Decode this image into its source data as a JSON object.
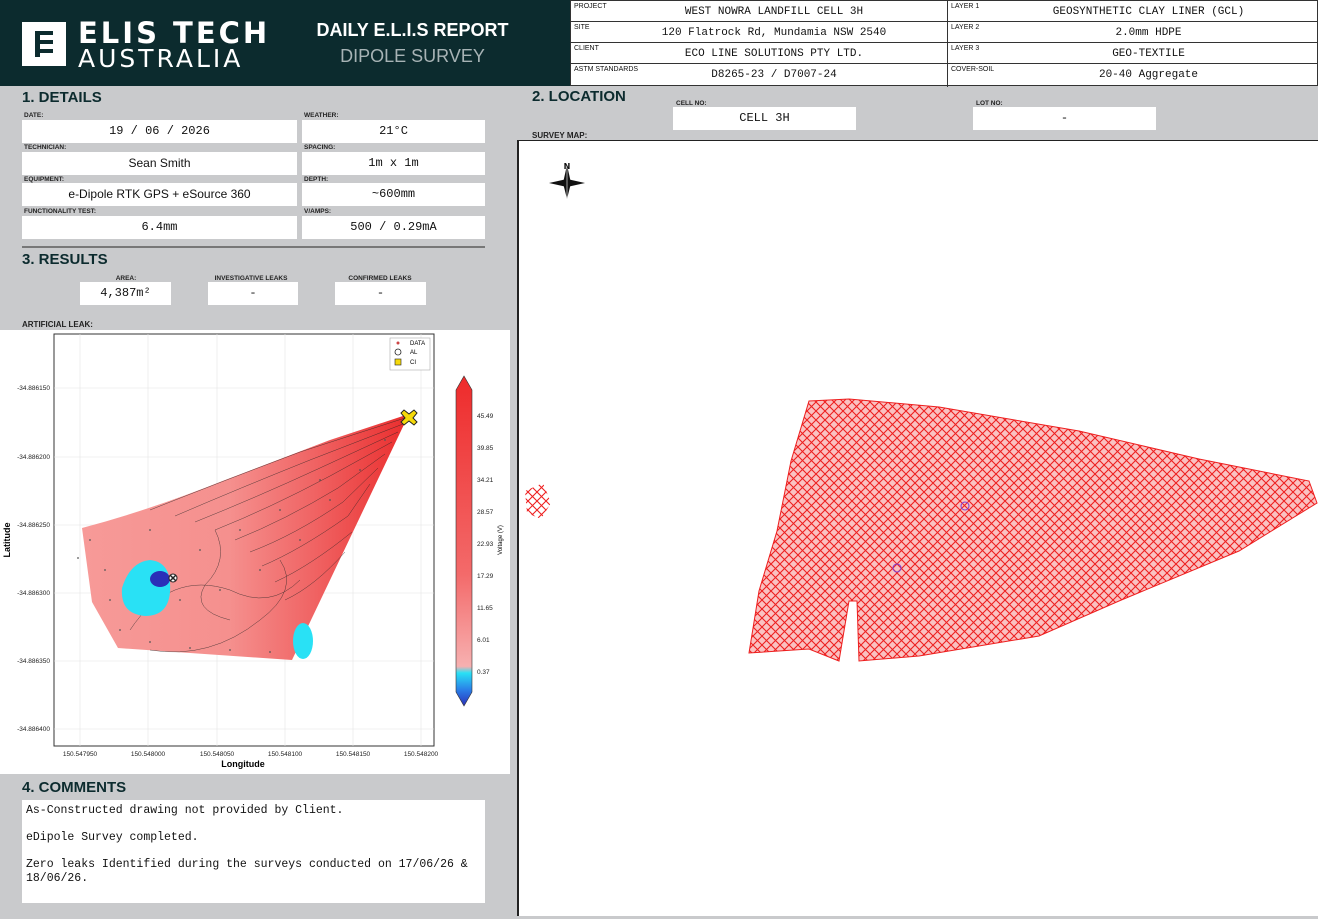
{
  "brand": {
    "line1": "ELIS TECH",
    "line2": "AUSTRALIA"
  },
  "report": {
    "title": "DAILY E.L.I.S REPORT",
    "subtitle": "DIPOLE SURVEY"
  },
  "meta": {
    "project_label": "PROJECT",
    "project": "WEST NOWRA LANDFILL CELL 3H",
    "site_label": "SITE",
    "site": "120 Flatrock Rd, Mundamia NSW 2540",
    "client_label": "CLIENT",
    "client": "ECO LINE SOLUTIONS PTY LTD.",
    "astm_label": "ASTM STANDARDS",
    "astm": "D8265-23 / D7007-24",
    "layer1_label": "LAYER 1",
    "layer1": "GEOSYNTHETIC CLAY LINER (GCL)",
    "layer2_label": "LAYER 2",
    "layer2": "2.0mm HDPE",
    "layer3_label": "LAYER 3",
    "layer3": "GEO-TEXTILE",
    "cover_label": "COVER-SOIL",
    "cover": "20-40 Aggregate"
  },
  "details": {
    "title": "1. DETAILS",
    "date_label": "DATE:",
    "date": "19 / 06 / 2026",
    "weather_label": "WEATHER:",
    "weather": "21°C",
    "technician_label": "TECHNICIAN:",
    "technician": "Sean Smith",
    "spacing_label": "SPACING:",
    "spacing": "1m x 1m",
    "equipment_label": "EQUIPMENT:",
    "equipment": "e-Dipole RTK GPS + eSource 360",
    "depth_label": "DEPTH:",
    "depth": "~600mm",
    "functionality_label": "FUNCTIONALITY TEST:",
    "functionality": "6.4mm",
    "vamps_label": "V/AMPS:",
    "vamps": "500 / 0.29mA"
  },
  "location": {
    "title": "2. LOCATION",
    "cell_label": "CELL No:",
    "cell": "CELL 3H",
    "lot_label": "LOT No:",
    "lot": "-",
    "survey_map_label": "SURVEY MAP:",
    "north": "N"
  },
  "results": {
    "title": "3. RESULTS",
    "area_label": "AREA:",
    "area": "4,387m²",
    "investigative_label": "INVESTIGATIVE LEAKS",
    "investigative": "-",
    "confirmed_label": "CONFIRMED LEAKS",
    "confirmed": "-",
    "artificial_label": "ARTIFICIAL LEAK:"
  },
  "chart_data": {
    "type": "heatmap",
    "xlabel": "Longitude",
    "ylabel": "Latitude",
    "x_ticks": [
      "150.547950",
      "150.548000",
      "150.548050",
      "150.548100",
      "150.548150",
      "150.548200"
    ],
    "y_ticks": [
      "-34.886150",
      "-34.886200",
      "-34.886250",
      "-34.886300",
      "-34.886350",
      "-34.886400"
    ],
    "colorbar_label": "Voltage (V)",
    "colorbar_ticks": [
      "45.49",
      "39.85",
      "34.21",
      "28.57",
      "22.93",
      "17.29",
      "11.65",
      "6.01",
      "0.37"
    ],
    "legend": [
      "DATA",
      "AL",
      "CI"
    ],
    "colors": {
      "high": "#ee2b2b",
      "mid": "#f39a9a",
      "low": "#29e1f5",
      "lowest": "#2a2fb8"
    }
  },
  "comments": {
    "title": "4. COMMENTS",
    "line1": "As-Constructed drawing not provided by Client.",
    "line2": "eDipole Survey completed.",
    "line3": "Zero leaks Identified during the surveys conducted on 17/06/26 & 18/06/26."
  }
}
